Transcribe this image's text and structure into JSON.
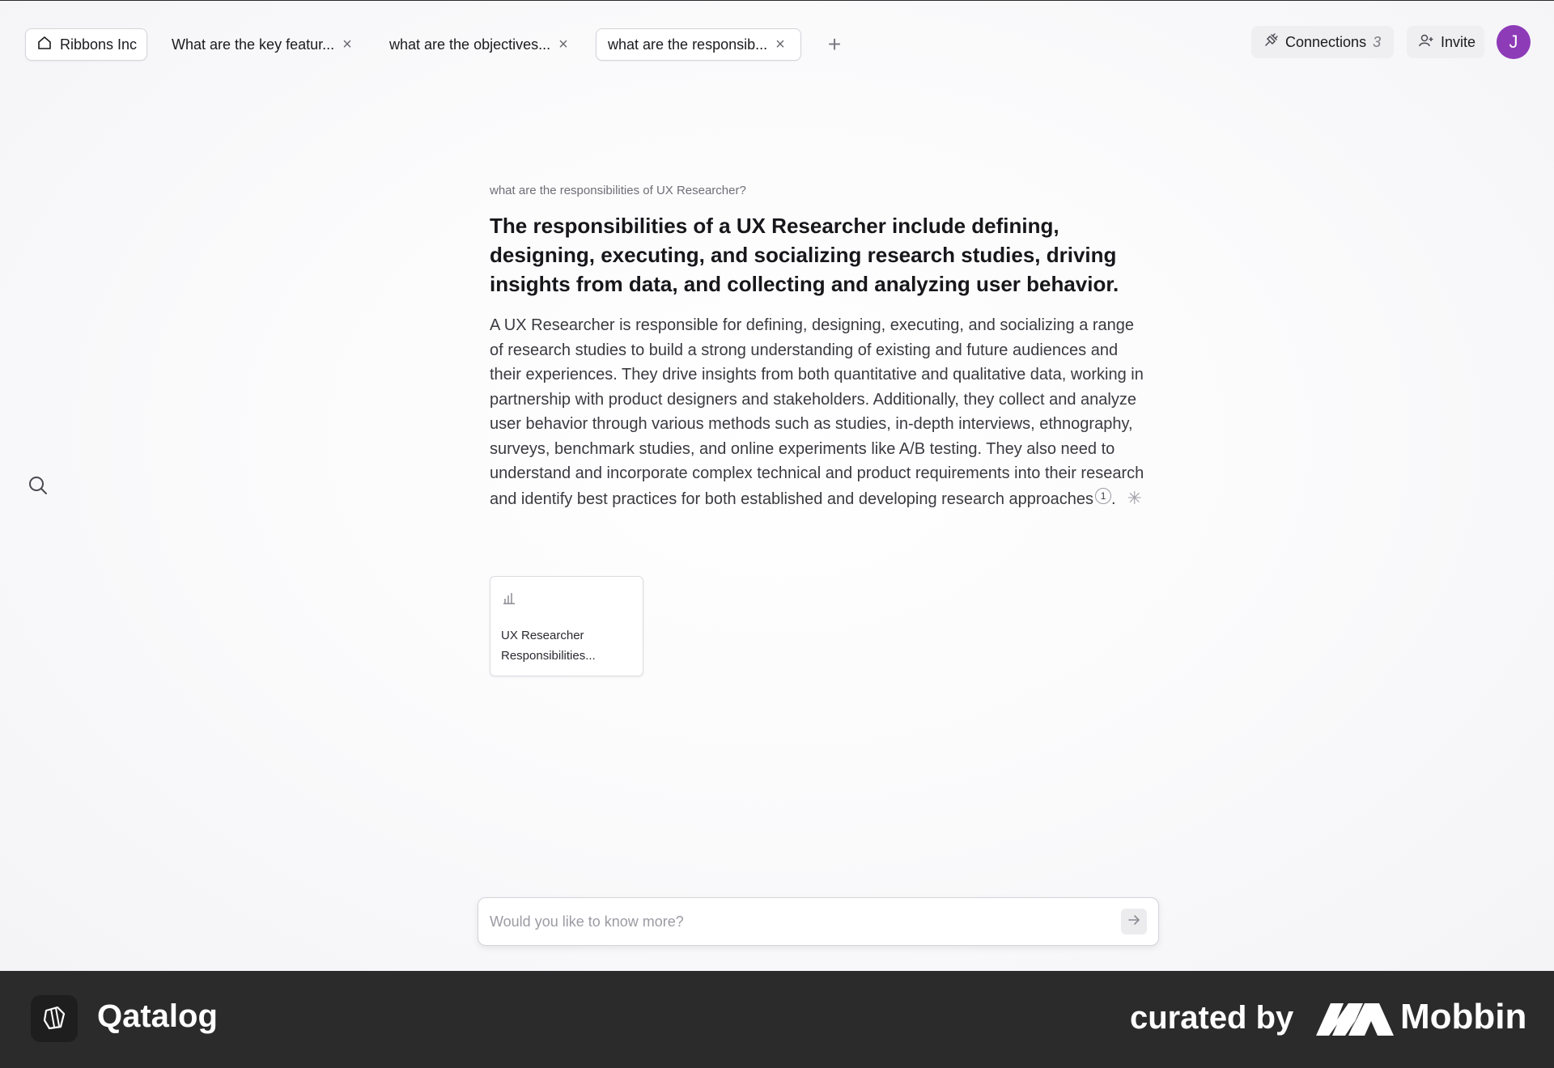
{
  "tabs": {
    "home": {
      "label": "Ribbons Inc",
      "icon": "home-icon"
    },
    "items": [
      {
        "label": "What are the key featur...",
        "icon": "close-icon"
      },
      {
        "label": "what are the objectives...",
        "icon": "close-icon"
      },
      {
        "label": "what are the responsib...",
        "icon": "close-icon",
        "active": true
      }
    ],
    "add_icon": "plus-icon"
  },
  "header": {
    "connections_label": "Connections",
    "connections_count": "3",
    "invite_label": "Invite",
    "avatar_initial": "J",
    "avatar_color": "#8e3bb8"
  },
  "sidebar": {
    "search_icon": "search-icon"
  },
  "answer": {
    "question": "what are the responsibilities of UX Researcher?",
    "headline": "The responsibilities of a UX Researcher include defining, designing, executing, and socializing research studies, driving insights from data, and collecting and analyzing user behavior.",
    "body": "A UX Researcher is responsible for defining, designing, executing, and socializing a range of research studies to build a strong understanding of existing and future audiences and their experiences. They drive insights from both quantitative and qualitative data, working in partnership with product designers and stakeholders. Additionally, they collect and analyze user behavior through various methods such as studies, in-depth interviews, ethnography, surveys, benchmark studies, and online experiments like A/B testing. They also need to understand and incorporate complex technical and product requirements into their research and identify best practices for both established and developing research approaches",
    "citation": "1",
    "end_punct": "."
  },
  "source_card": {
    "icon": "bar-chart-icon",
    "title_line1": "UX Researcher",
    "title_line2": "Responsibilities..."
  },
  "ask": {
    "placeholder": "Would you like to know more?",
    "send_icon": "arrow-right-icon"
  },
  "footer": {
    "app_name": "Qatalog",
    "curated_label": "curated by",
    "brand": "Mobbin"
  }
}
